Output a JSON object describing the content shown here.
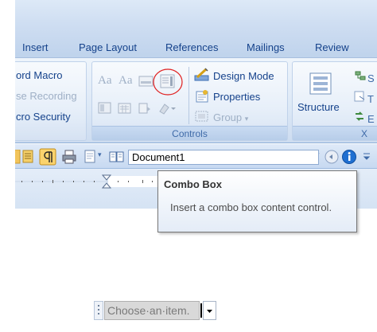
{
  "ribbon_tabs": [
    "Insert",
    "Page Layout",
    "References",
    "Mailings",
    "Review"
  ],
  "code_group": {
    "record_macro": "ord Macro",
    "pause_recording": "se Recording",
    "macro_security": "cro Security"
  },
  "controls_group": {
    "label": "Controls",
    "rich_text_control": "Aa",
    "plain_text_control": "Aa",
    "design_mode": "Design Mode",
    "properties": "Properties",
    "group": "Group"
  },
  "xml_group": {
    "structure": "Structure",
    "label_fragment": "X"
  },
  "quick_access": {
    "document_name": "Document1"
  },
  "tooltip": {
    "title": "Combo Box",
    "description": "Insert a combo box content control."
  },
  "combo_control": {
    "placeholder": "Choose·an·item."
  },
  "colors": {
    "ribbon_text": "#15428b",
    "highlight_circle": "#e02020",
    "placeholder_bg": "#d9d9d9"
  }
}
